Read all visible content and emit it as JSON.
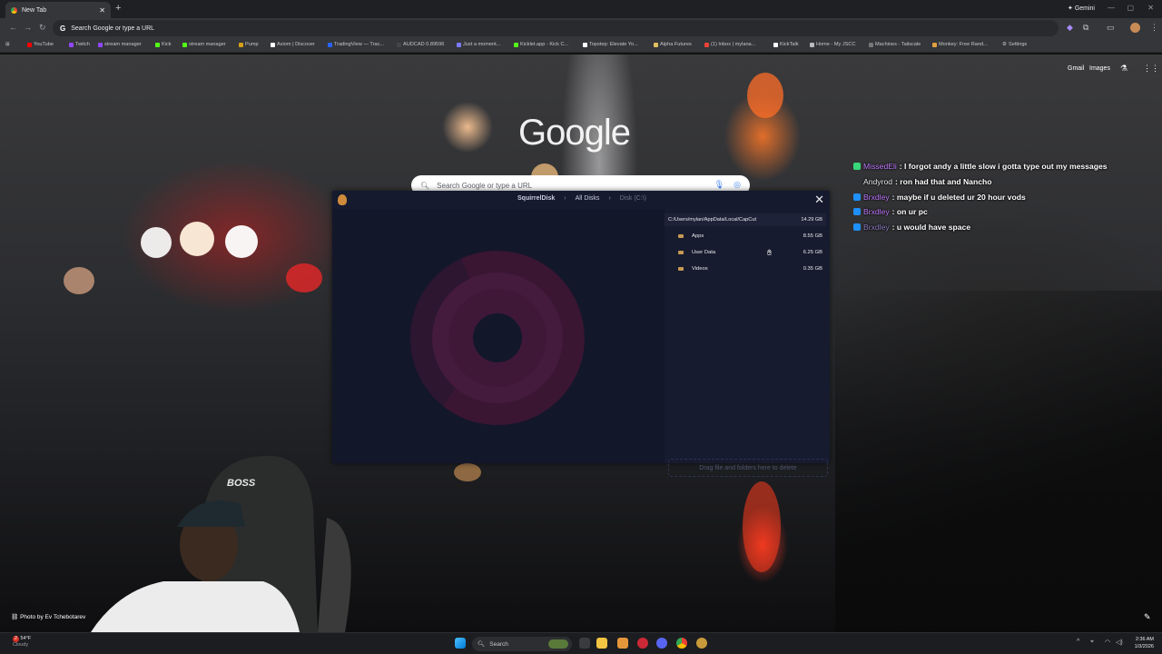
{
  "browser": {
    "tab_title": "New Tab",
    "new_tab_symbol": "+",
    "gemini_label": "Gemini",
    "omnibox_text": "Search Google or type a URL"
  },
  "bookmarks": [
    {
      "label": "YouTube",
      "color": "#ff0000"
    },
    {
      "label": "Twitch",
      "color": "#9146ff"
    },
    {
      "label": "stream manager",
      "color": "#9146ff"
    },
    {
      "label": "Kick",
      "color": "#53fc18"
    },
    {
      "label": "stream manager",
      "color": "#53fc18"
    },
    {
      "label": "Pump",
      "color": "#d4a017"
    },
    {
      "label": "Axiom | Discover",
      "color": "#ffffff"
    },
    {
      "label": "TradingView — Trac...",
      "color": "#2962ff"
    },
    {
      "label": "AUDCAD 0.89596",
      "color": "#444444"
    },
    {
      "label": "Just a moment...",
      "color": "#7a7aff"
    },
    {
      "label": "Kicklet.app - Kick C...",
      "color": "#53fc18"
    },
    {
      "label": "Topstep: Elevate Yo...",
      "color": "#ffffff"
    },
    {
      "label": "Alpha Futures",
      "color": "#e0c060"
    },
    {
      "label": "(1) Inbox | mylana...",
      "color": "#ea4335"
    },
    {
      "label": "KickTalk",
      "color": "#ffffff"
    },
    {
      "label": "Home - My JSCC",
      "color": "#bbbbbb"
    },
    {
      "label": "Machines - Tailscale",
      "color": "#777777"
    },
    {
      "label": "Monkey: Free Rand...",
      "color": "#e0a040"
    },
    {
      "label": "Settings",
      "color": "#9aa0a6"
    }
  ],
  "google": {
    "gmail_link": "Gmail",
    "images_link": "Images",
    "logo_text": "Google",
    "search_placeholder": "Search Google or type a URL",
    "photo_credit": "Photo by Ev Tchebotarev"
  },
  "chat": [
    {
      "user": "MissedEli",
      "message": ": I forgot andy a little slow i gotta type out my messages",
      "color": "#c07cff",
      "badge": "#37d67a"
    },
    {
      "user": "Andyrod",
      "message": ": ron had that and Nancho",
      "color": "#e8eaed",
      "badge": ""
    },
    {
      "user": "Brxdley",
      "message": ": maybe if u deleted ur 20 hour vods",
      "color": "#c07cff",
      "badge": "#1e90ff"
    },
    {
      "user": "Brxdley",
      "message": ": on ur pc",
      "color": "#c07cff",
      "badge": "#1e90ff"
    },
    {
      "user": "Brxdley",
      "message": ": u would have space",
      "color": "#8e7cc3",
      "badge": "#1e90ff"
    }
  ],
  "squirreldisk": {
    "breadcrumbs": [
      "SquirrelDisk",
      "All Disks",
      "Disk (C:\\)"
    ],
    "current_path": "C:/Users/mylan/AppData/Local/CapCut",
    "current_size": "14.29 GB",
    "folders": [
      {
        "name": "Apps",
        "size": "8.55 GB"
      },
      {
        "name": "User Data",
        "size": "6.25 GB"
      },
      {
        "name": "Videos",
        "size": "0.35 GB"
      }
    ],
    "dropzone_text": "Drag file and folders here to delete"
  },
  "taskbar": {
    "weather_temp": "54°F",
    "weather_desc": "Cloudy",
    "search_placeholder": "Search",
    "time": "2:36 AM",
    "date": "1/3/2026",
    "notification_count": "2"
  }
}
